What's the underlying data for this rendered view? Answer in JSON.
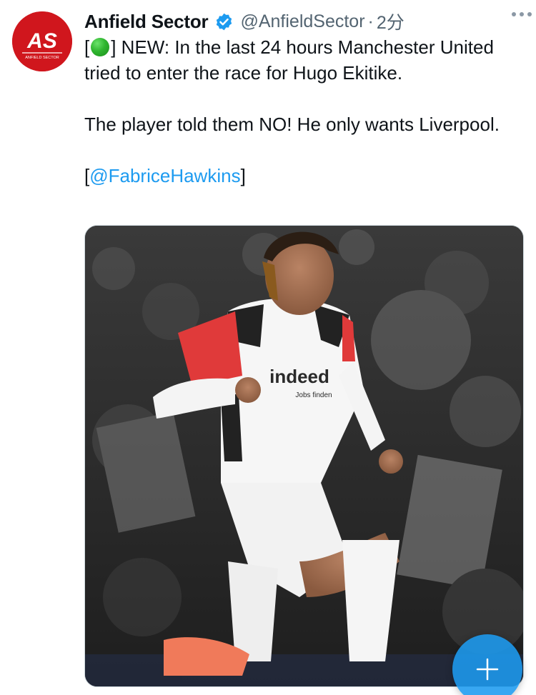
{
  "tweet": {
    "author": {
      "display_name": "Anfield Sector",
      "handle": "@AnfieldSector",
      "separator": "·",
      "time": "2分",
      "avatar_text": "AS",
      "avatar_subtext": "ANFIELD SECTOR",
      "verified": true
    },
    "text": {
      "line1_open": "[",
      "line1_emoji": "green-circle",
      "line1_rest": "] NEW: In the last 24 hours Manchester United tried to enter the race for Hugo Ekitike.",
      "line2": "The player told them NO! He only wants Liverpool.",
      "source_open": "[",
      "source_mention": "@FabriceHawkins",
      "source_close": "]"
    },
    "media": {
      "shirt_sponsor": "indeed",
      "shirt_sponsor_sub": "Jobs finden"
    }
  },
  "colors": {
    "mention": "#1d9bf0",
    "verified": "#1d9bf0",
    "avatar_bg": "#d0161d",
    "secondary_text": "#536471",
    "fab": "#1d9bf0"
  },
  "icons": {
    "more": "more-horizontal-icon",
    "verified": "verified-badge-icon",
    "compose": "compose-plus-icon"
  }
}
